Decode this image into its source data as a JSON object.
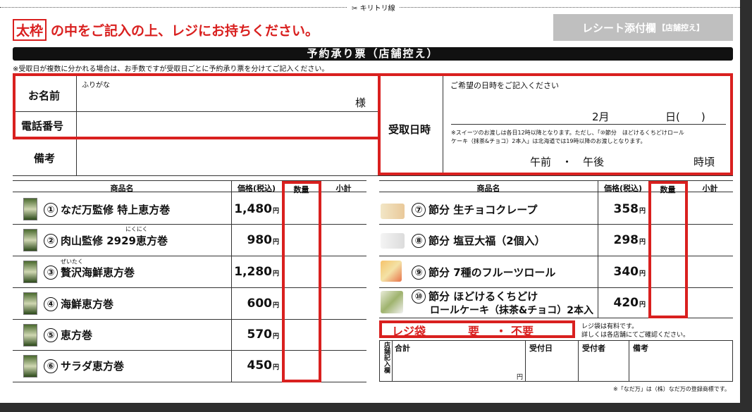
{
  "cut_label": "キリトリ線",
  "headline": {
    "boxed": "太枠",
    "rest": "の中をご記入の上、レジにお持ちください。"
  },
  "receipt_button": {
    "main": "レシート添付欄",
    "sub": "【店舗控え】"
  },
  "title": "予約承り票（店舗控え）",
  "note": "※受取日が複数に分かれる場合は、お手数ですが受取日ごとに予約承り票を分けてご記入ください。",
  "customer": {
    "name_label": "お名前",
    "furigana": "ふりがな",
    "sama": "様",
    "phone_label": "電話番号",
    "remarks_label": "備考"
  },
  "pickup": {
    "label": "受取日時",
    "instruction": "ご希望の日時をご記入ください",
    "month_text": "2月",
    "day_text": "日(　　)",
    "note_line1": "※スイーツのお渡しは各日12時以降となります。ただし、「⑩節分　ほどけるくちどけロール",
    "note_line2": "ケーキ（抹茶&チョコ）2本入」は北海道では19時以降のお渡しとなります。",
    "ampm": "午前　・　午後",
    "time_suffix": "時頃"
  },
  "table_headers": {
    "product": "商品名",
    "price": "価格(税込)",
    "qty": "数量",
    "subtotal": "小計"
  },
  "yen_unit": "円",
  "left_products": [
    {
      "no": "①",
      "name": "なだ万監修 特上恵方巻",
      "price": "1,480",
      "ruby": ""
    },
    {
      "no": "②",
      "name": "肉山監修 2929恵方巻",
      "price": "980",
      "ruby": "にくにく"
    },
    {
      "no": "③",
      "name": "贅沢海鮮恵方巻",
      "price": "1,280",
      "ruby": "ぜいたく"
    },
    {
      "no": "④",
      "name": "海鮮恵方巻",
      "price": "600",
      "ruby": ""
    },
    {
      "no": "⑤",
      "name": "恵方巻",
      "price": "570",
      "ruby": ""
    },
    {
      "no": "⑥",
      "name": "サラダ恵方巻",
      "price": "450",
      "ruby": ""
    }
  ],
  "right_products": [
    {
      "no": "⑦",
      "name": "節分 生チョコクレープ",
      "price": "358"
    },
    {
      "no": "⑧",
      "name": "節分 塩豆大福（2個入）",
      "price": "298"
    },
    {
      "no": "⑨",
      "name": "節分 7種のフルーツロール",
      "price": "340"
    },
    {
      "no": "⑩",
      "name": "節分 ほどけるくちどけ",
      "name2": "ロールケーキ（抹茶&チョコ）2本入",
      "price": "420"
    }
  ],
  "bag": {
    "label": "レジ袋",
    "need": "要",
    "dot": "・",
    "notneed": "不要",
    "note1": "レジ袋は有料です。",
    "note2": "詳しくは各店舗にてご確認ください。"
  },
  "store_box": {
    "side_label": "店舗記入欄",
    "total": "合計",
    "received_date": "受付日",
    "receiver": "受付者",
    "remarks": "備考",
    "yen": "円"
  },
  "trademark": "※「なだ万」は（株）なだ万の登録商標です。"
}
